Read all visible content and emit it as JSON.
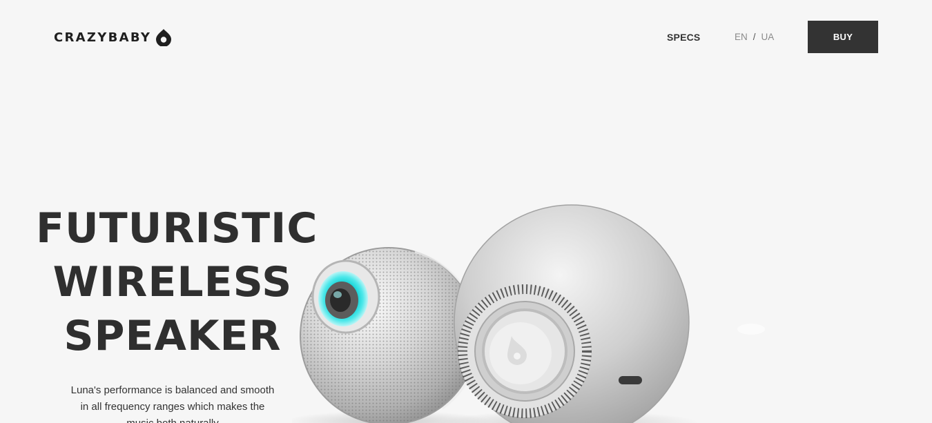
{
  "header": {
    "logo_text": "CRAZYBABY",
    "logo_icon": "crazybaby-drop-icon",
    "nav": {
      "specs_label": "SPECS"
    },
    "lang": {
      "en": "EN",
      "separator": "/",
      "ua": "UA"
    },
    "buy_label": "BUY"
  },
  "hero": {
    "title_lines": [
      "FUTURISTIC",
      "WIRELESS",
      "SPEAKER"
    ],
    "description": "Luna's performance is balanced and smooth in all frequency ranges which makes the music both naturally"
  },
  "colors": {
    "background": "#f6f6f6",
    "button": "#333333",
    "text": "#2f2f2f",
    "accent_glow": "#27d6d6"
  }
}
